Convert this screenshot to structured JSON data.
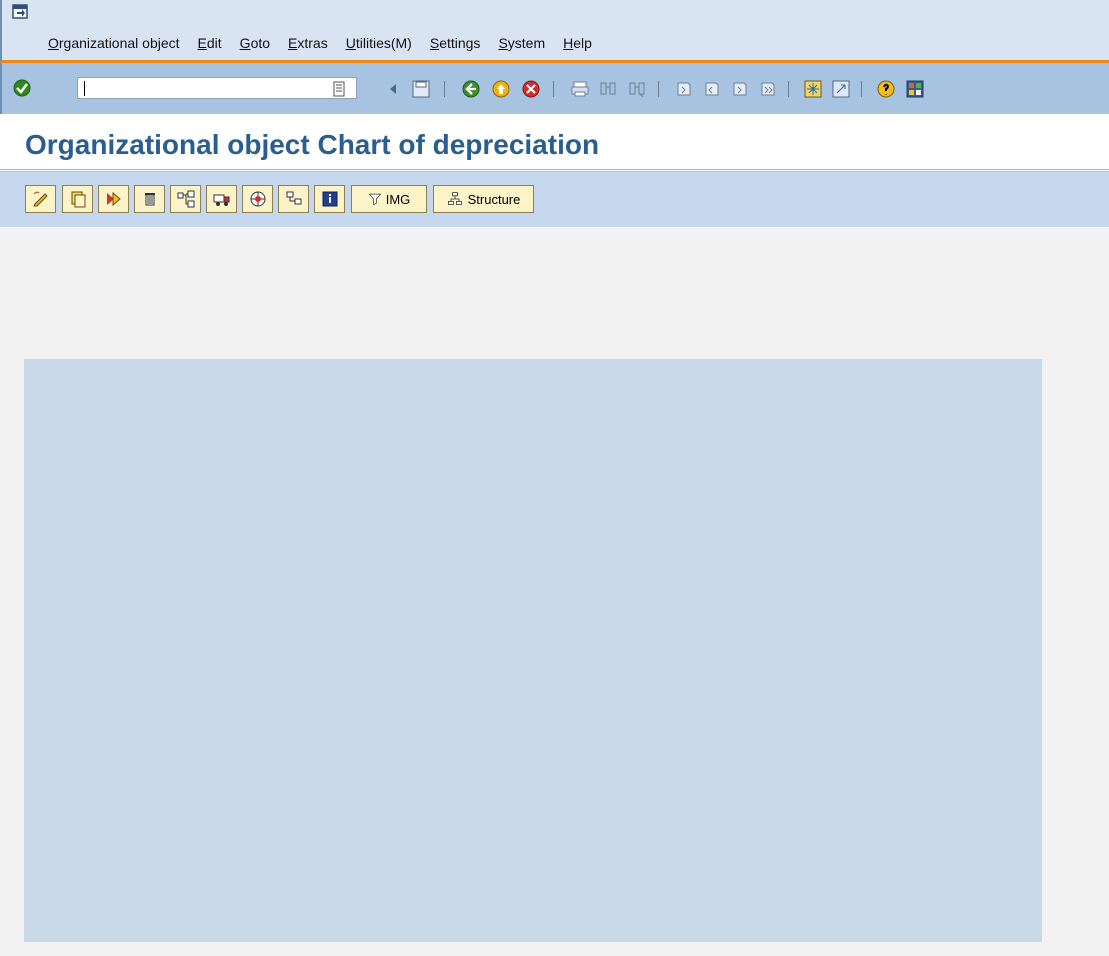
{
  "menubar": {
    "items": [
      "Organizational object",
      "Edit",
      "Goto",
      "Extras",
      "Utilities(M)",
      "Settings",
      "System",
      "Help"
    ]
  },
  "title": "Organizational object Chart of depreciation",
  "app_toolbar": {
    "img_label": "IMG",
    "structure_label": "Structure"
  },
  "colors": {
    "menubar_bg": "#d9e4f2",
    "toolbar_bg": "#a8c3e1",
    "accent_orange": "#ef8b15",
    "title_text": "#2a5e8e",
    "panel_bg": "#c9d9e7"
  }
}
